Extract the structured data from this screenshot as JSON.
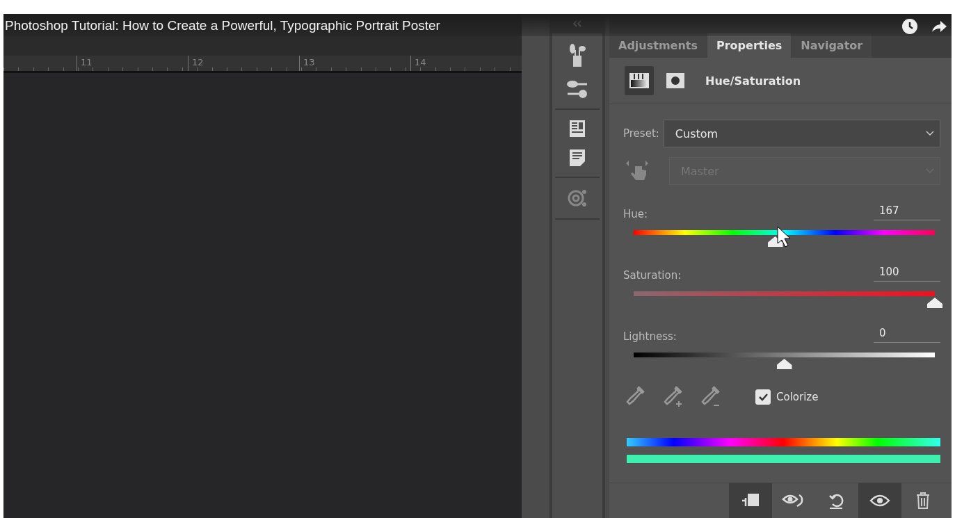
{
  "video": {
    "title": "Photoshop Tutorial: How to Create a Powerful, Typographic Portrait Poster"
  },
  "ruler": {
    "marks": [
      "11",
      "12",
      "13",
      "14"
    ]
  },
  "tabs": [
    {
      "label": "Adjustments",
      "selected": false
    },
    {
      "label": "Properties",
      "selected": true
    },
    {
      "label": "Navigator",
      "selected": false
    }
  ],
  "properties": {
    "title": "Hue/Saturation",
    "preset": {
      "label": "Preset:",
      "value": "Custom"
    },
    "channel": {
      "value": "Master",
      "disabled": true
    },
    "sliders": [
      {
        "kind": "hue",
        "label": "Hue:",
        "value": "167",
        "level": 0.47
      },
      {
        "kind": "saturation",
        "label": "Saturation:",
        "value": "100",
        "level": 1
      },
      {
        "kind": "lightness",
        "label": "Lightness:",
        "value": "0",
        "level": 0.5
      }
    ],
    "colorize": {
      "label": "Colorize",
      "checked": true
    },
    "footer_buttons": [
      {
        "kind": "clip",
        "selected": true
      },
      {
        "kind": "view-previous",
        "selected": false
      },
      {
        "kind": "reset",
        "selected": false
      },
      {
        "kind": "visibility",
        "selected": true
      },
      {
        "kind": "delete",
        "selected": false
      }
    ]
  }
}
